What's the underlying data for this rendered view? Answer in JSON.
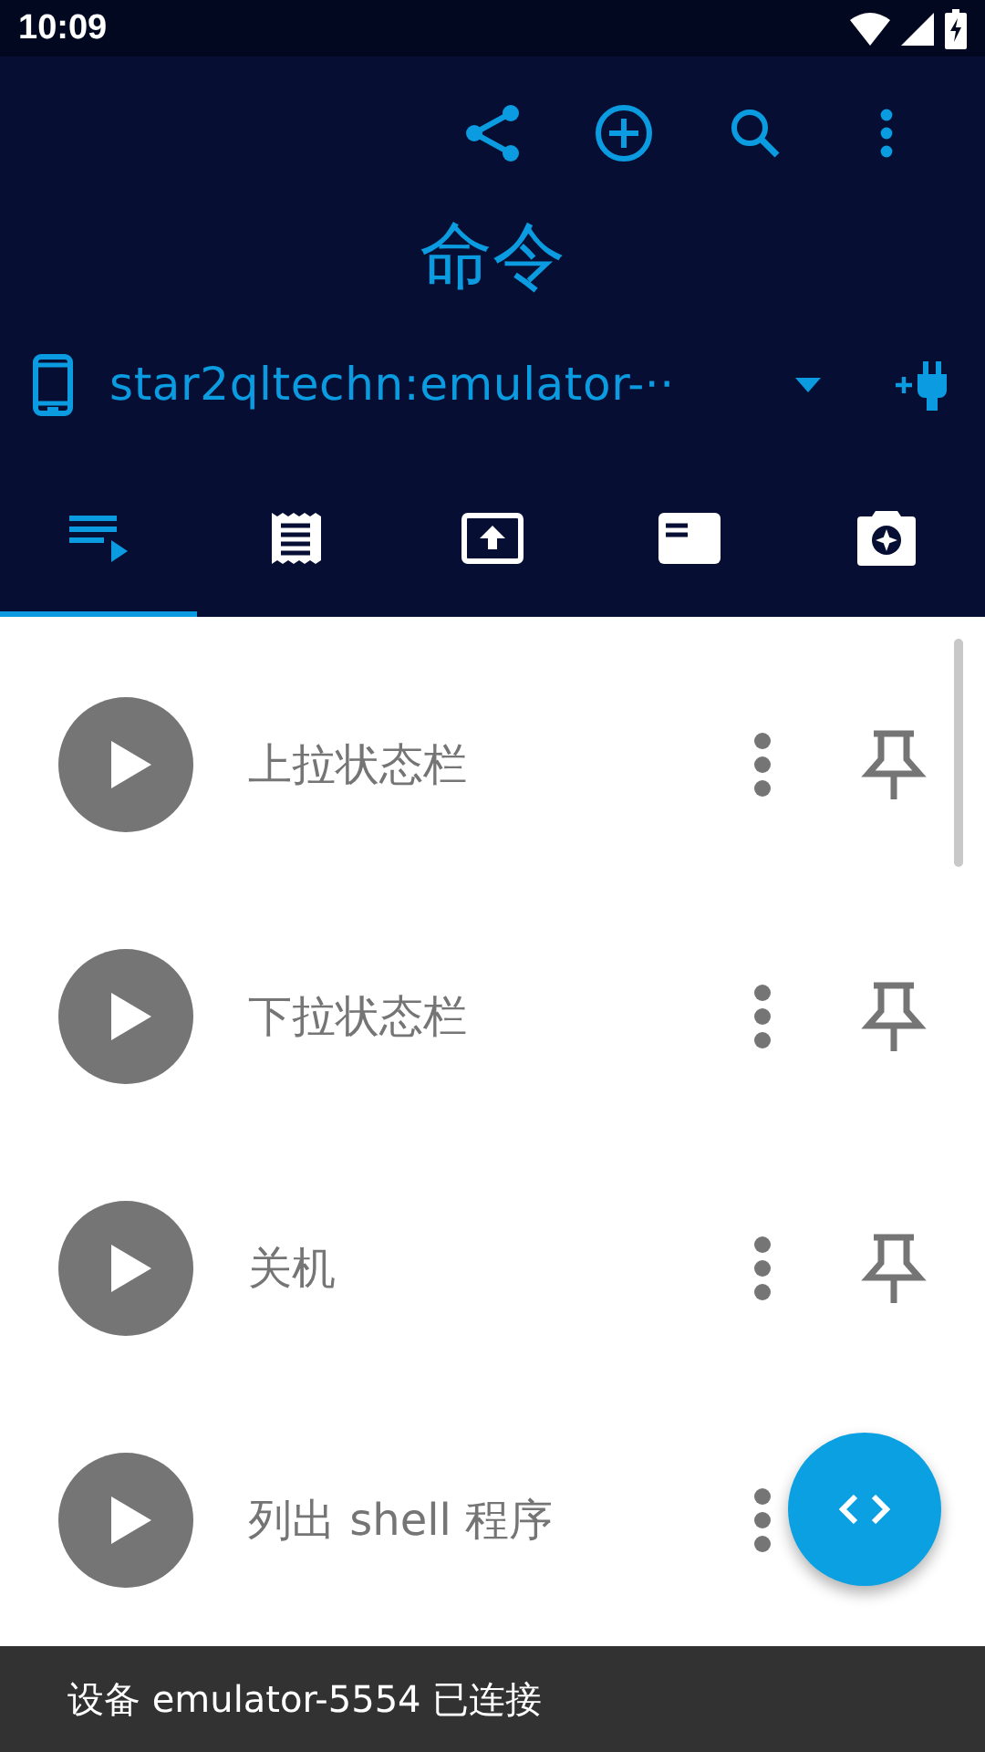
{
  "status_bar": {
    "time": "10:09"
  },
  "app_bar": {
    "title": "命令",
    "device": "star2qltechn:emulator-··"
  },
  "tabs": [
    {
      "kind": "queue",
      "selected": true
    },
    {
      "kind": "receipt",
      "selected": false
    },
    {
      "kind": "upload",
      "selected": false
    },
    {
      "kind": "card",
      "selected": false
    },
    {
      "kind": "camera",
      "selected": false
    }
  ],
  "commands": [
    {
      "name": "上拉状态栏",
      "pin_shown": true
    },
    {
      "name": "下拉状态栏",
      "pin_shown": true
    },
    {
      "name": "关机",
      "pin_shown": true
    },
    {
      "name": "列出 shell 程序",
      "pin_shown": false
    }
  ],
  "snackbar": {
    "message": "设备 emulator-5554 已连接"
  }
}
